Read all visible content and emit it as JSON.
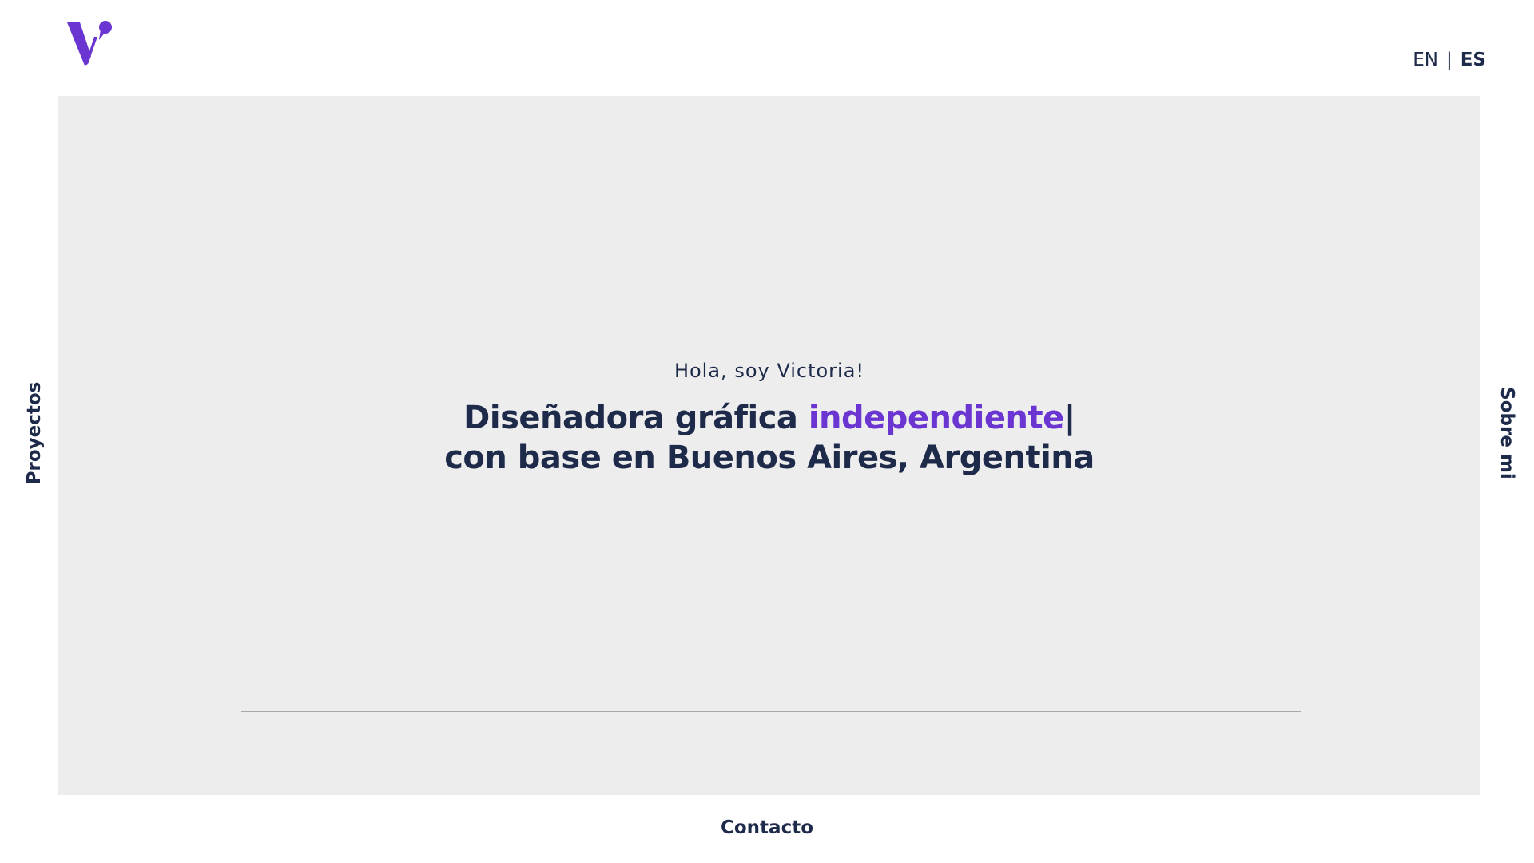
{
  "header": {
    "logo_icon": "victoria-v-logo-icon",
    "languages": [
      {
        "label": "EN",
        "active": false
      },
      {
        "label": "ES",
        "active": true
      }
    ],
    "separator": "|"
  },
  "hero": {
    "greeting": "Hola, soy Victoria!",
    "headline_part1": "Diseñadora gráfica ",
    "headline_accent": "independiente",
    "headline_cursor": "|",
    "headline_line2": "con base en Buenos Aires, Argentina"
  },
  "nav": {
    "left": "Proyectos",
    "right": "Sobre mi",
    "bottom": "Contacto"
  },
  "colors": {
    "accent": "#6a35d0",
    "text": "#1e2a4a",
    "hero_background": "#ededee"
  }
}
